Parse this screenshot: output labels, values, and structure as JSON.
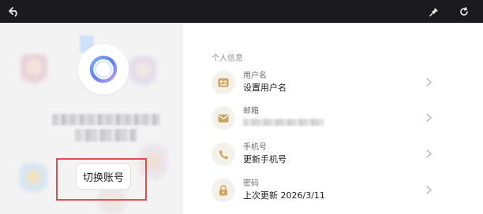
{
  "titlebar": {
    "back_icon": "undo-arrow-icon",
    "pin_icon": "pin-icon",
    "refresh_icon": "refresh-icon"
  },
  "profile": {
    "switch_account_label": "切换账号"
  },
  "info": {
    "section_title": "个人信息",
    "rows": [
      {
        "label": "用户名",
        "value": "设置用户名",
        "icon": "id-card-icon"
      },
      {
        "label": "邮箱",
        "value": "",
        "icon": "mail-icon"
      },
      {
        "label": "手机号",
        "value": "更新手机号",
        "icon": "phone-icon"
      },
      {
        "label": "密码",
        "value": "上次更新 2026/3/11",
        "icon": "lock-icon"
      }
    ]
  },
  "colors": {
    "titlebar_bg": "#1b1b1d",
    "left_panel_bg": "#f3f3f4",
    "icon_accent": "#c9a560",
    "highlight": "#ea4a4d"
  }
}
